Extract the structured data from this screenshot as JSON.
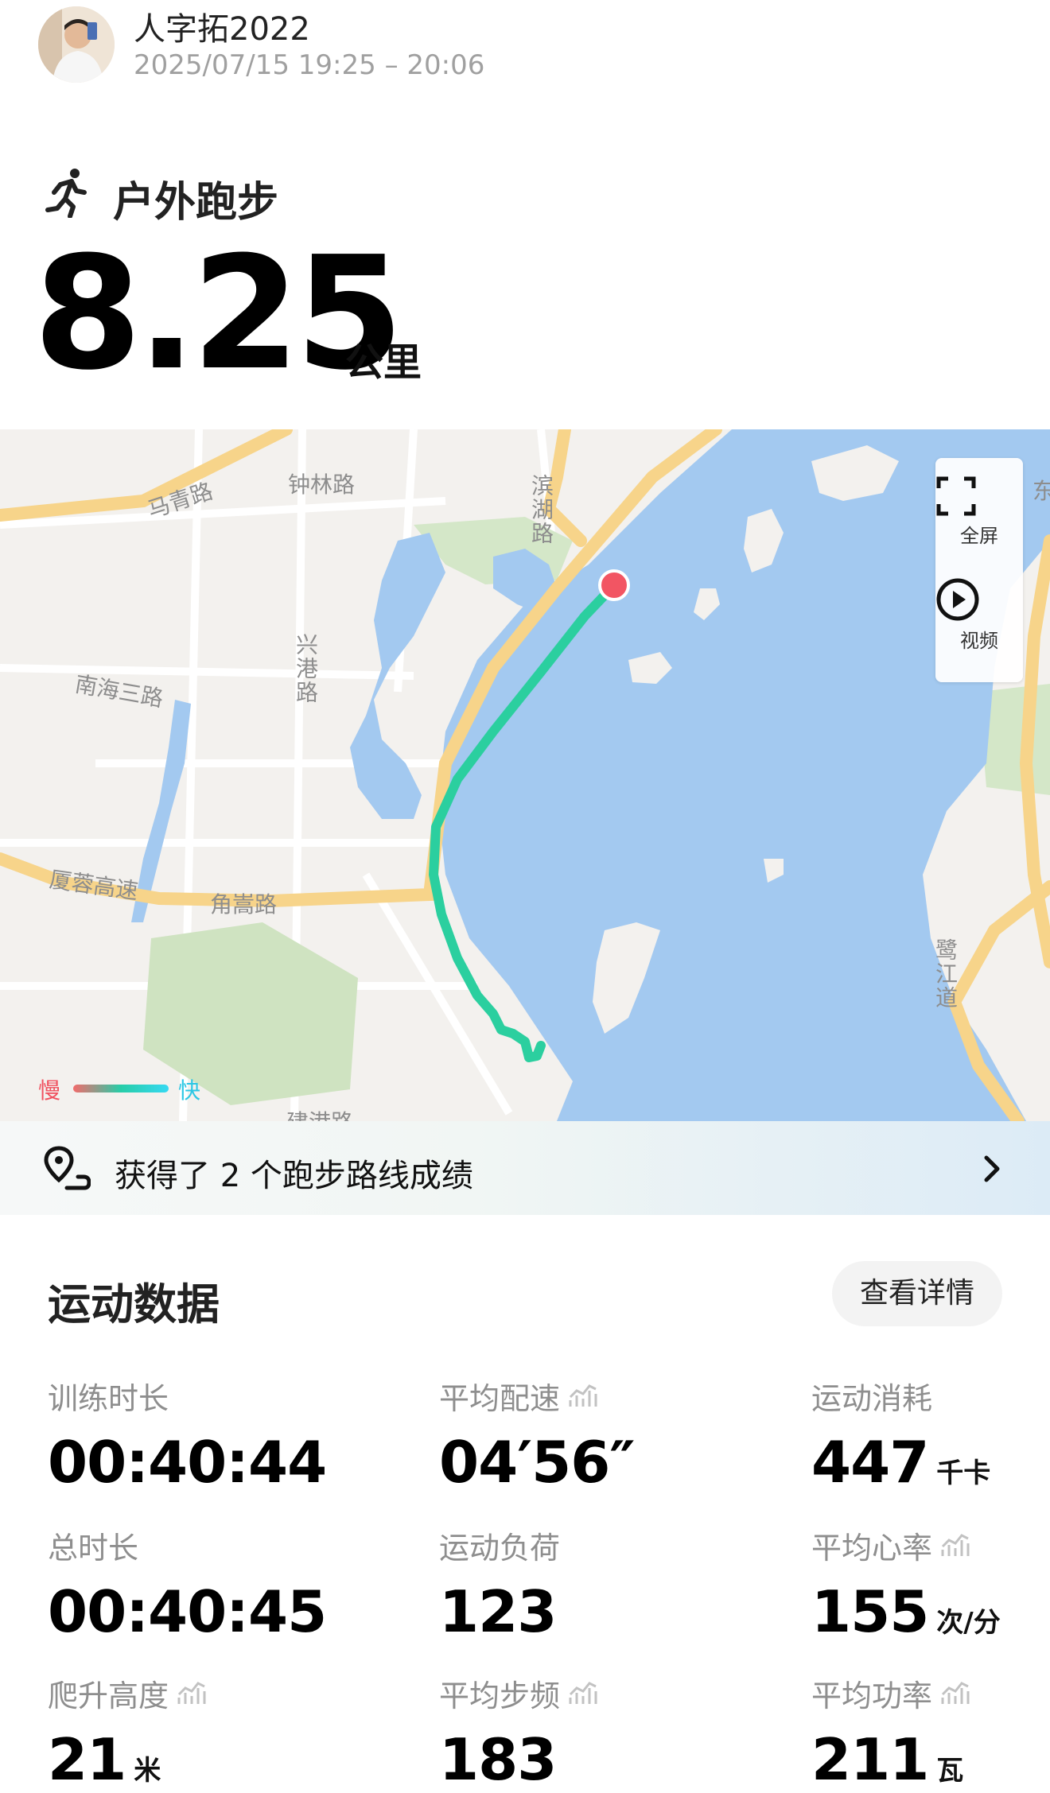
{
  "header": {
    "username": "人字拓2022",
    "time_range": "2025/07/15 19:25 – 20:06"
  },
  "workout": {
    "sport_type": "户外跑步",
    "sport_icon": "running-person-icon",
    "distance_value": "8.25",
    "distance_unit": "公里"
  },
  "map": {
    "road_labels": [
      "马青路",
      "钟林路",
      "滨湖路",
      "兴港路",
      "南海三路",
      "厦蓉高速",
      "角嵩路",
      "鹭江道",
      "东",
      "建港路"
    ],
    "controls": {
      "fullscreen_label": "全屏",
      "video_label": "视频"
    },
    "legend": {
      "slow_label": "慢",
      "fast_label": "快"
    },
    "colors": {
      "water": "#a3c9f0",
      "route_slow": "#f26b6b",
      "route_fast": "#2ad0a4",
      "marker": "#f25563"
    }
  },
  "achievement": {
    "text": "获得了 2 个跑步路线成绩"
  },
  "stats": {
    "title": "运动数据",
    "detail_button": "查看详情",
    "items": [
      {
        "label": "训练时长",
        "value": "00:40:44",
        "unit": ""
      },
      {
        "label": "平均配速",
        "value": "04′56″",
        "unit": ""
      },
      {
        "label": "运动消耗",
        "value": "447",
        "unit": "千卡"
      },
      {
        "label": "总时长",
        "value": "00:40:45",
        "unit": ""
      },
      {
        "label": "运动负荷",
        "value": "123",
        "unit": ""
      },
      {
        "label": "平均心率",
        "value": "155",
        "unit": "次/分"
      },
      {
        "label": "爬升高度",
        "value": "21",
        "unit": "米"
      },
      {
        "label": "平均步频",
        "value": "183",
        "unit": ""
      },
      {
        "label": "平均功率",
        "value": "211",
        "unit": "瓦"
      }
    ]
  }
}
